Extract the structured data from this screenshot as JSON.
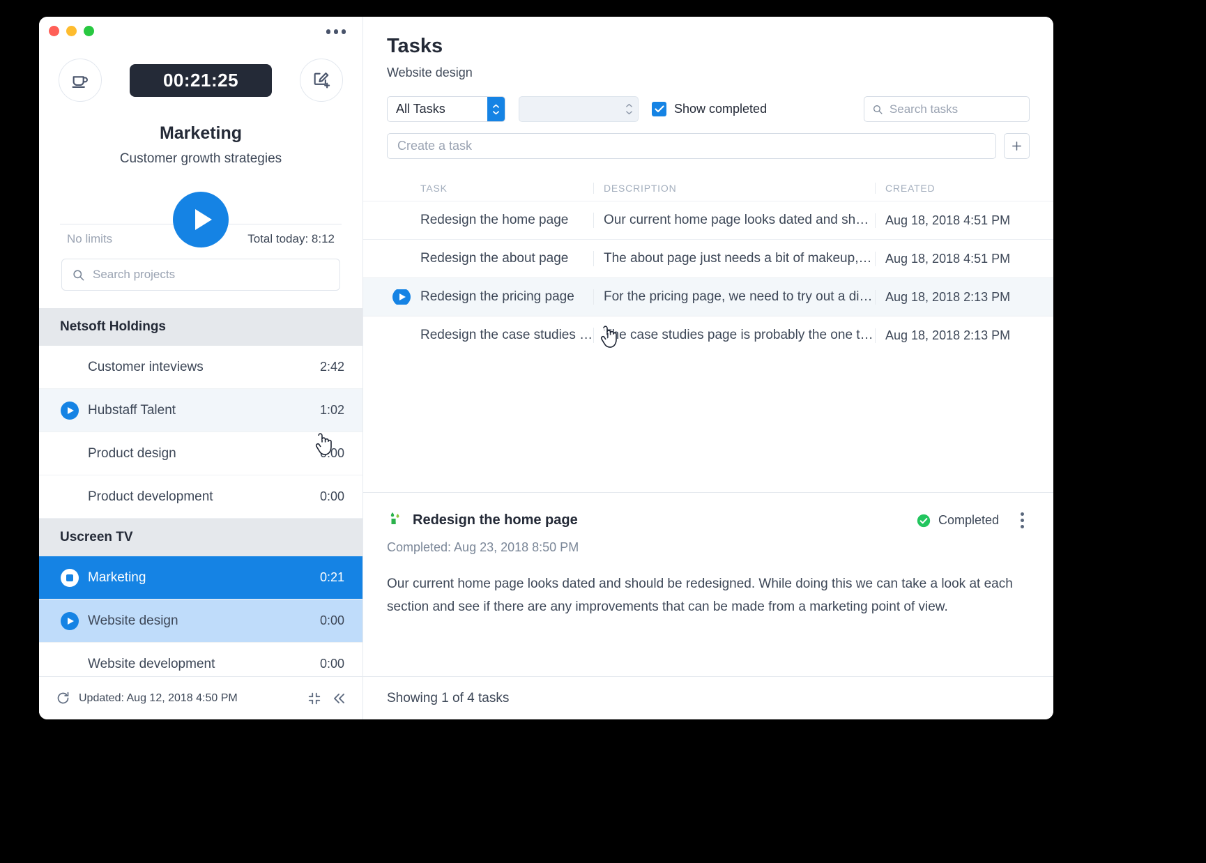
{
  "window": {
    "traffic_lights": [
      "close",
      "minimize",
      "zoom"
    ],
    "more_menu": "more-options"
  },
  "tracker": {
    "break_button_label": "break",
    "timer": "00:21:25",
    "edit_button_label": "new-entry",
    "project_name": "Marketing",
    "project_task": "Customer growth strategies",
    "play_button_label": "start-timer",
    "limits_label": "No limits",
    "total_today_label": "Total today: 8:12",
    "search_projects_placeholder": "Search projects",
    "search_projects_value": ""
  },
  "projects": {
    "groups": [
      {
        "name": "Netsoft Holdings",
        "items": [
          {
            "name": "Customer inteviews",
            "time": "2:42",
            "state": "idle"
          },
          {
            "name": "Hubstaff Talent",
            "time": "1:02",
            "state": "hover"
          },
          {
            "name": "Product design",
            "time": "0:00",
            "state": "idle"
          },
          {
            "name": "Product development",
            "time": "0:00",
            "state": "idle"
          }
        ]
      },
      {
        "name": "Uscreen TV",
        "items": [
          {
            "name": "Marketing",
            "time": "0:21",
            "state": "active"
          },
          {
            "name": "Website design",
            "time": "0:00",
            "state": "selected"
          },
          {
            "name": "Website development",
            "time": "0:00",
            "state": "idle"
          }
        ]
      }
    ]
  },
  "sidebar_footer": {
    "updated_text": "Updated: Aug 12, 2018 4:50 PM",
    "refresh_icon": "refresh-icon",
    "compact_icon": "compact-icon",
    "collapse_icon": "collapse-icon"
  },
  "tasks_panel": {
    "title": "Tasks",
    "subtitle": "Website design",
    "filter_primary": "All Tasks",
    "filter_secondary": "",
    "show_completed_label": "Show completed",
    "show_completed_checked": true,
    "search_placeholder": "Search tasks",
    "search_value": "",
    "create_placeholder": "Create a task",
    "create_value": "",
    "add_button_label": "+",
    "columns": [
      "TASK",
      "DESCRIPTION",
      "CREATED"
    ],
    "rows": [
      {
        "task": "Redesign the home page",
        "description": "Our current home page looks dated and should…",
        "created": "Aug 18, 2018 4:51 PM",
        "state": "idle"
      },
      {
        "task": "Redesign the about page",
        "description": "The about page just needs a bit of makeup, bec…",
        "created": "Aug 18, 2018 4:51 PM",
        "state": "idle"
      },
      {
        "task": "Redesign the pricing page",
        "description": "For the pricing page, we need to try out a differe…",
        "created": "Aug 18, 2018 2:13 PM",
        "state": "hover"
      },
      {
        "task": "Redesign the case studies pa…",
        "description": "The case studies page is probably the one that …",
        "created": "Aug 18, 2018 2:13 PM",
        "state": "idle"
      }
    ]
  },
  "task_detail": {
    "source_icon": "hubstaff-tasks-icon",
    "title": "Redesign the home page",
    "status": "Completed",
    "completed_line": "Completed: Aug 23, 2018 8:50 PM",
    "body": "Our current home page looks dated and should be redesigned. While doing this we can take a look at each section and see if there are any improvements that can be made from a marketing point of view.",
    "menu_icon": "kebab-menu-icon"
  },
  "main_footer": {
    "showing_text": "Showing 1 of 4 tasks"
  },
  "colors": {
    "accent_blue": "#1583e4",
    "selected_blue": "#bfdcfa",
    "status_green": "#22c55e",
    "dark": "#242a37"
  }
}
